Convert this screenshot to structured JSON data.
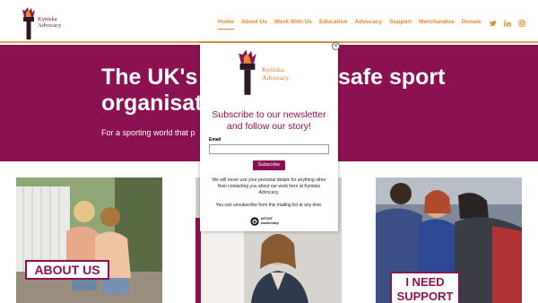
{
  "brand": {
    "name_line1": "Kyniska",
    "name_line2": "Advocacy"
  },
  "nav": {
    "items": [
      {
        "label": "Home",
        "active": true
      },
      {
        "label": "About Us",
        "active": false
      },
      {
        "label": "Work With Us",
        "active": false
      },
      {
        "label": "Education",
        "active": false
      },
      {
        "label": "Advocacy",
        "active": false
      },
      {
        "label": "Support",
        "active": false
      },
      {
        "label": "Merchandise",
        "active": false
      },
      {
        "label": "Donate",
        "active": false
      }
    ]
  },
  "social": {
    "twitter": "twitter-icon",
    "linkedin": "linkedin-icon",
    "instagram": "instagram-icon"
  },
  "hero": {
    "title_left": "The UK's\norganisat",
    "title_right": "safe sport",
    "subtitle": "For a sporting world that p"
  },
  "cards": {
    "card1_label": "ABOUT US",
    "card3_label_line1": "I NEED",
    "card3_label_line2": "SUPPORT"
  },
  "modal": {
    "close": "×",
    "logo_line1": "Kyniska",
    "logo_line2": "Advocacy",
    "heading": "Subscribe to our newsletter and follow our story!",
    "email_label": "Email",
    "email_value": "",
    "subscribe_label": "Subscribe",
    "privacy_text": "We will never use your personal details for anything other than contacting you about our work here at Kyniska Advocacy.",
    "unsubscribe_text": "You can unsubscribe from this mailing list at any time.",
    "mailchimp_line1": "INTUIT",
    "mailchimp_line2": "mailchimp"
  },
  "colors": {
    "brand_magenta": "#8c1153",
    "accent_orange": "#e08a2c"
  }
}
